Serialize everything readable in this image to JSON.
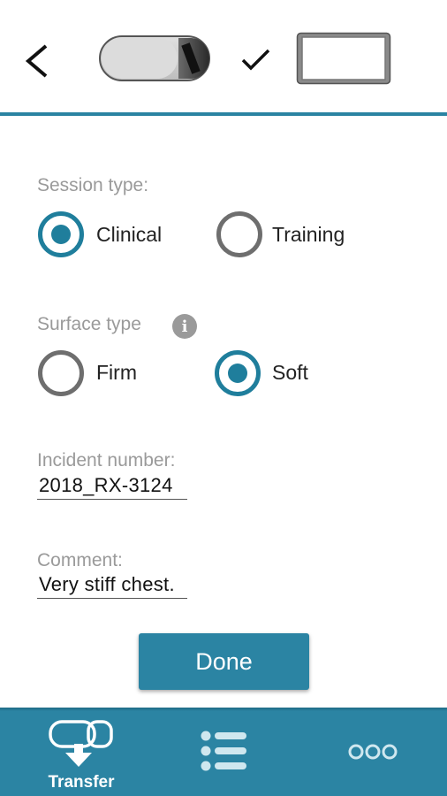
{
  "form": {
    "session_type": {
      "label": "Session type:",
      "options": [
        {
          "label": "Clinical",
          "selected": true
        },
        {
          "label": "Training",
          "selected": false
        }
      ]
    },
    "surface_type": {
      "label": "Surface type",
      "info_icon": "i",
      "options": [
        {
          "label": "Firm",
          "selected": false
        },
        {
          "label": "Soft",
          "selected": true
        }
      ]
    },
    "incident_number": {
      "label": "Incident number:",
      "value": "2018_RX-3124"
    },
    "comment": {
      "label": "Comment:",
      "value": "Very stiff chest."
    },
    "done_label": "Done"
  },
  "bottom_nav": {
    "transfer_label": "Transfer"
  },
  "colors": {
    "accent": "#2b84a3",
    "radio_selected": "#1f7e9c",
    "radio_unselected": "#6e6e6e",
    "label_gray": "#9a9a9a"
  }
}
